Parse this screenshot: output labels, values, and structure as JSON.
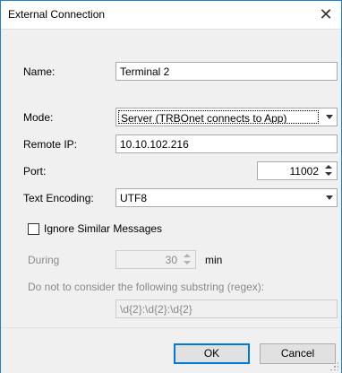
{
  "window": {
    "title": "External Connection"
  },
  "form": {
    "name_label": "Name:",
    "name_value": "Terminal 2",
    "mode_label": "Mode:",
    "mode_value": "Server (TRBOnet connects to App)",
    "remote_ip_label": "Remote IP:",
    "remote_ip_value": "10.10.102.216",
    "port_label": "Port:",
    "port_value": "11002",
    "encoding_label": "Text Encoding:",
    "encoding_value": "UTF8",
    "ignore_label": "Ignore Similar Messages",
    "ignore_checked": false,
    "during_label": "During",
    "during_value": "30",
    "during_unit": "min",
    "regex_label": "Do not to consider the following substring (regex):",
    "regex_value": "\\d{2}:\\d{2}:\\d{2}"
  },
  "buttons": {
    "ok": "OK",
    "cancel": "Cancel"
  },
  "icons": {
    "close": "close-icon",
    "dropdown": "chevron-down-icon",
    "spin": "spin-arrows-icon"
  },
  "colors": {
    "accent": "#0078d7",
    "window_border": "#1883d7",
    "client_bg": "#f0f0f0"
  }
}
